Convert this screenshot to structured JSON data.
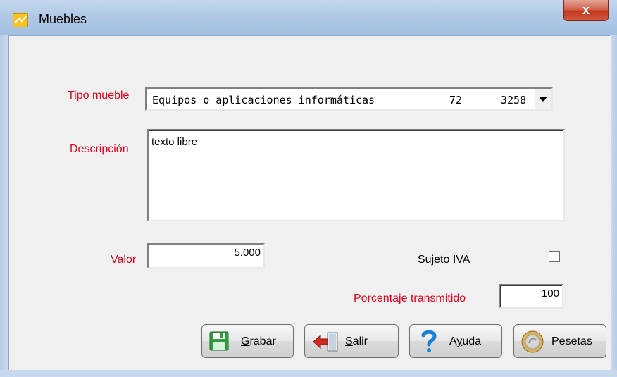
{
  "window": {
    "title": "Muebles",
    "close_glyph": "x"
  },
  "form": {
    "tipo_mueble_label": "Tipo mueble",
    "tipo_mueble_value": "Equipos o aplicaciones informáticas",
    "tipo_mueble_code1": "72",
    "tipo_mueble_code2": "3258",
    "descripcion_label": "Descripción",
    "descripcion_value": "texto libre",
    "valor_label": "Valor",
    "valor_value": "5.000",
    "sujeto_iva_label": "Sujeto IVA",
    "sujeto_iva_checked": false,
    "porcentaje_label": "Porcentaje transmitido",
    "porcentaje_value": "100"
  },
  "buttons": {
    "grabar_first": "G",
    "grabar_rest": "rabar",
    "salir_first": "S",
    "salir_rest": "alir",
    "ayuda_pre": "A",
    "ayuda_underlined": "y",
    "ayuda_rest": "uda",
    "pesetas_label": "Pesetas"
  },
  "icons": {
    "app": "app-window-icon",
    "grabar": "floppy-disk-icon",
    "salir": "exit-arrow-icon",
    "ayuda": "question-mark-icon",
    "pesetas": "coin-icon"
  },
  "colors": {
    "label_red": "#e8001c",
    "titlebar": "#b1c9e6",
    "close_red": "#c2391f"
  }
}
